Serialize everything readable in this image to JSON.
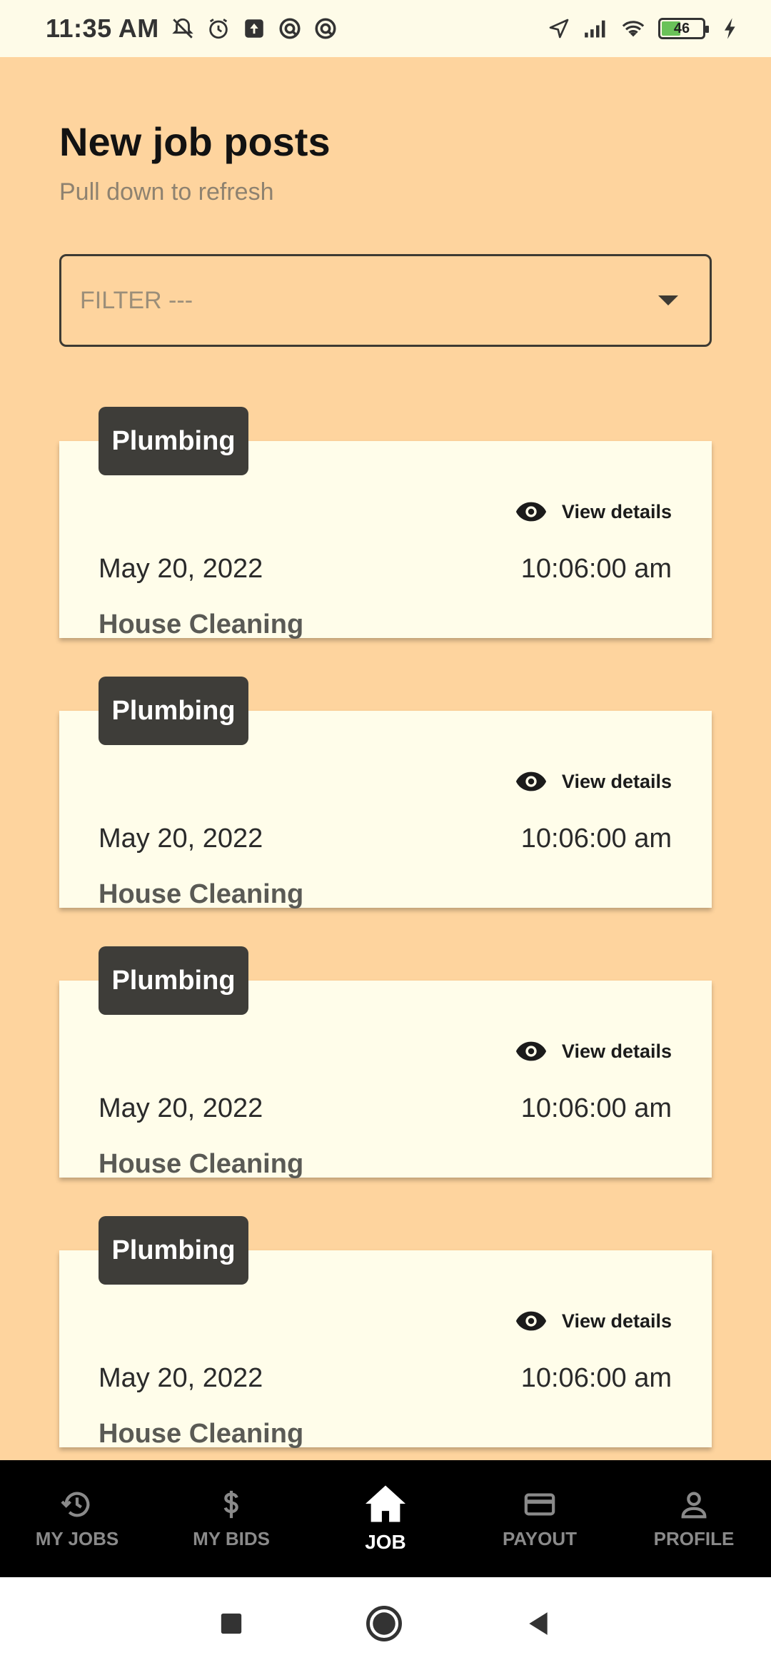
{
  "status_bar": {
    "time": "11:35 AM",
    "battery": "46",
    "icons_left": [
      "bell-off-icon",
      "alarm-icon",
      "upload-icon",
      "app-icon",
      "app-icon"
    ],
    "icons_right": [
      "location-icon",
      "signal-icon",
      "wifi-icon",
      "battery-icon",
      "charging-icon"
    ]
  },
  "header": {
    "title": "New job posts",
    "subtitle": "Pull down to refresh"
  },
  "filter": {
    "placeholder": "FILTER ---"
  },
  "jobs": [
    {
      "tag": "Plumbing",
      "view_label": "View details",
      "date": "May 20, 2022",
      "time": "10:06:00 am",
      "name": "House Cleaning"
    },
    {
      "tag": "Plumbing",
      "view_label": "View details",
      "date": "May 20, 2022",
      "time": "10:06:00 am",
      "name": "House Cleaning"
    },
    {
      "tag": "Plumbing",
      "view_label": "View details",
      "date": "May 20, 2022",
      "time": "10:06:00 am",
      "name": "House Cleaning"
    },
    {
      "tag": "Plumbing",
      "view_label": "View details",
      "date": "May 20, 2022",
      "time": "10:06:00 am",
      "name": "House Cleaning"
    }
  ],
  "bottom_nav": {
    "items": [
      {
        "label": "MY JOBS",
        "icon": "history-icon"
      },
      {
        "label": "MY BIDS",
        "icon": "dollar-icon"
      },
      {
        "label": "JOB",
        "icon": "home-icon",
        "active": true
      },
      {
        "label": "PAYOUT",
        "icon": "credit-card-icon"
      },
      {
        "label": "PROFILE",
        "icon": "person-icon"
      }
    ]
  },
  "colors": {
    "background": "#fed49e",
    "card": "#fffdea",
    "tag": "#3e3d39",
    "nav": "#000000"
  }
}
